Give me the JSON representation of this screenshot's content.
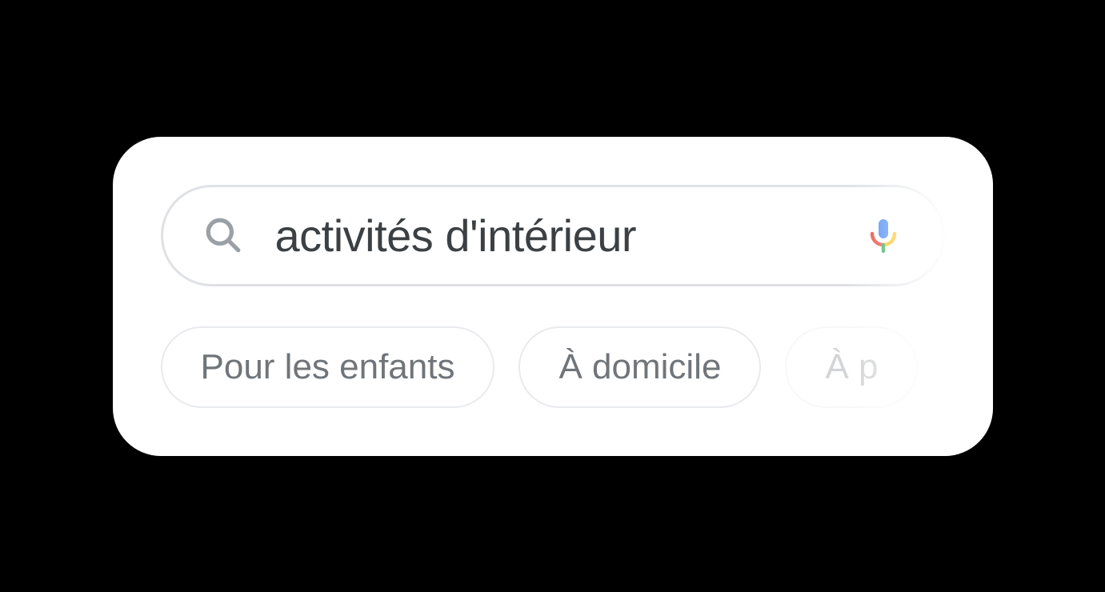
{
  "search": {
    "query": "activités d'intérieur"
  },
  "chips": [
    {
      "label": "Pour les enfants"
    },
    {
      "label": "À domicile"
    },
    {
      "label": "À p"
    }
  ]
}
